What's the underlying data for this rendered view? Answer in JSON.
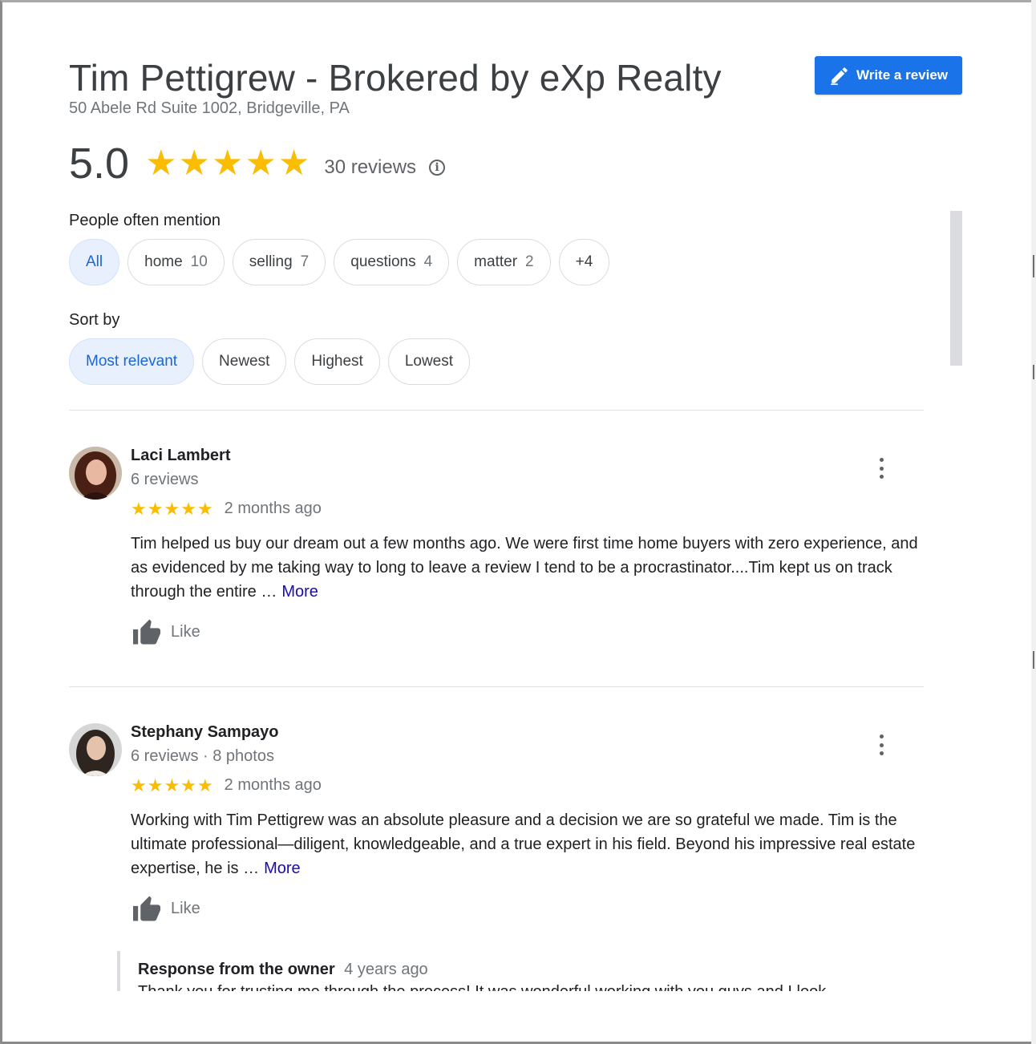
{
  "business": {
    "name": "Tim Pettigrew - Brokered by eXp Realty",
    "address": "50 Abele Rd Suite 1002, Bridgeville, PA",
    "write_review_label": "Write a review"
  },
  "rating": {
    "score": "5.0",
    "stars": 5,
    "review_count": "30 reviews"
  },
  "mentions": {
    "label": "People often mention",
    "chips": [
      {
        "label": "All",
        "count": "",
        "selected": true
      },
      {
        "label": "home",
        "count": "10"
      },
      {
        "label": "selling",
        "count": "7"
      },
      {
        "label": "questions",
        "count": "4"
      },
      {
        "label": "matter",
        "count": "2"
      },
      {
        "label": "+4",
        "count": ""
      }
    ]
  },
  "sort": {
    "label": "Sort by",
    "options": [
      "Most relevant",
      "Newest",
      "Highest",
      "Lowest"
    ],
    "selected": "Most relevant"
  },
  "reviews": [
    {
      "author": "Laci Lambert",
      "meta": "6 reviews",
      "stars": 5,
      "date": "2 months ago",
      "text": "Tim helped us buy our dream out a few months ago. We were first time home buyers with zero experience, and as evidenced by me taking way to long to leave a review I tend to be a procrastinator....Tim kept us on track through the entire …",
      "more": "More",
      "like": "Like"
    },
    {
      "author": "Stephany Sampayo",
      "meta": "6 reviews · 8 photos",
      "stars": 5,
      "date": "2 months ago",
      "text": "Working with Tim Pettigrew was an absolute pleasure and a decision we are so grateful we made. Tim is the ultimate professional—diligent, knowledgeable, and a true expert in his field. Beyond his impressive real estate expertise, he is …",
      "more": "More",
      "like": "Like"
    }
  ],
  "owner_response": {
    "label": "Response from the owner",
    "time": "4 years ago",
    "text": "Thank you for trusting me through the process! It was wonderful working with you guys and I look"
  },
  "colors": {
    "accent": "#1a73e8",
    "star": "#fbbc04",
    "link": "#1a0dab",
    "chip_selected_bg": "#e8f0fe"
  },
  "icons": [
    "pencil-icon",
    "star-icon",
    "info-icon",
    "more-vert-icon",
    "thumb-up-icon"
  ]
}
